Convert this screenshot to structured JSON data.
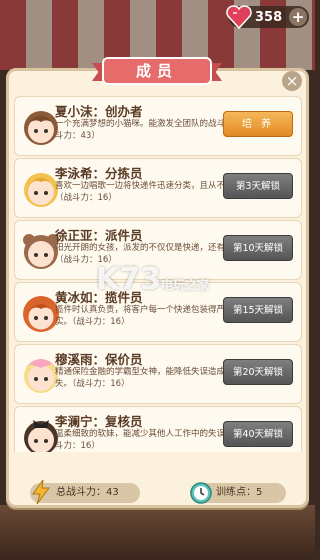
{
  "hud": {
    "gems": "358",
    "plus": "+"
  },
  "panel": {
    "title": "成员",
    "close": "×"
  },
  "members": [
    {
      "name": "夏小沫：创办者",
      "desc": "一个充满梦想的小猫咪。能激发全团队的战斗力。（战斗力：43）",
      "button": "培 养",
      "button_style": "orange"
    },
    {
      "name": "李泳希：分拣员",
      "desc": "喜欢一边唱歌一边将快递件迅速分类，且从不失误。（战斗力：16）",
      "button": "第3天解锁",
      "button_style": "gray"
    },
    {
      "name": "徐正亚：派件员",
      "desc": "阳光开朗的女孩，派发的不仅仅是快递，还有快乐。（战斗力：16）",
      "button": "第10天解锁",
      "button_style": "gray"
    },
    {
      "name": "黄冰如：揽件员",
      "desc": "揽件时认真负责，将客户每一个快递包装得严严实实。（战斗力：16）",
      "button": "第15天解锁",
      "button_style": "gray"
    },
    {
      "name": "穆溪雨：保价员",
      "desc": "精通保险金融的学霸型女神，能降低失误造成的损失。（战斗力：16）",
      "button": "第20天解锁",
      "button_style": "gray"
    },
    {
      "name": "李澜宁：复核员",
      "desc": "温柔细致的软妹，能减少其他人工作中的失误率。（战斗力：16）",
      "button": "第40天解锁",
      "button_style": "gray"
    }
  ],
  "footer": {
    "total_power": "总战斗力：43",
    "training_points": "训练点：5"
  },
  "watermark": {
    "main": "K73",
    "sub": "电玩之家"
  },
  "colors": {
    "title_ribbon": "#e56c6a",
    "cultivate_button": "#f0a040",
    "locked_button": "#666666",
    "panel_bg": "#fbf1dd"
  }
}
